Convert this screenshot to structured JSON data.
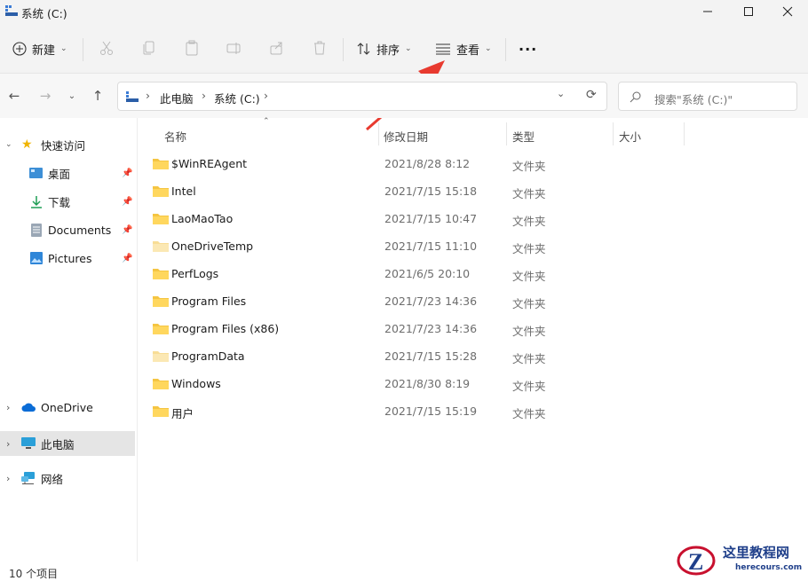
{
  "window": {
    "title": "系统 (C:)",
    "minimize_glyph": "—",
    "maximize_glyph": "☐",
    "close_glyph": "✕"
  },
  "toolbar": {
    "new_label": "新建",
    "sort_label": "排序",
    "view_label": "查看",
    "more_glyph": "···"
  },
  "address": {
    "breadcrumb": [
      "此电脑",
      "系统 (C:)"
    ],
    "search_placeholder": "搜索\"系统 (C:)\""
  },
  "sidebar": {
    "quick_access": "快速访问",
    "pinned": [
      {
        "label": "桌面",
        "icon": "desktop-icon"
      },
      {
        "label": "下载",
        "icon": "download-icon"
      },
      {
        "label": "Documents",
        "icon": "documents-icon"
      },
      {
        "label": "Pictures",
        "icon": "pictures-icon"
      }
    ],
    "onedrive": "OneDrive",
    "this_pc": "此电脑",
    "network": "网络"
  },
  "columns": {
    "name": "名称",
    "date": "修改日期",
    "type": "类型",
    "size": "大小"
  },
  "files": [
    {
      "name": "$WinREAgent",
      "date": "2021/8/28 8:12",
      "type": "文件夹"
    },
    {
      "name": "Intel",
      "date": "2021/7/15 15:18",
      "type": "文件夹"
    },
    {
      "name": "LaoMaoTao",
      "date": "2021/7/15 10:47",
      "type": "文件夹"
    },
    {
      "name": "OneDriveTemp",
      "date": "2021/7/15 11:10",
      "type": "文件夹"
    },
    {
      "name": "PerfLogs",
      "date": "2021/6/5 20:10",
      "type": "文件夹"
    },
    {
      "name": "Program Files",
      "date": "2021/7/23 14:36",
      "type": "文件夹"
    },
    {
      "name": "Program Files (x86)",
      "date": "2021/7/23 14:36",
      "type": "文件夹"
    },
    {
      "name": "ProgramData",
      "date": "2021/7/15 15:28",
      "type": "文件夹"
    },
    {
      "name": "Windows",
      "date": "2021/8/30 8:19",
      "type": "文件夹"
    },
    {
      "name": "用户",
      "date": "2021/7/15 15:19",
      "type": "文件夹"
    }
  ],
  "status": {
    "item_count": "10 个项目"
  },
  "watermark": {
    "site_name": "这里教程网",
    "site_url": "herecours.com"
  },
  "colors": {
    "accent": "#0067c0",
    "folder": "#f5c542",
    "arrow": "#e83a2f",
    "selected_bg": "#e5e5e5"
  }
}
